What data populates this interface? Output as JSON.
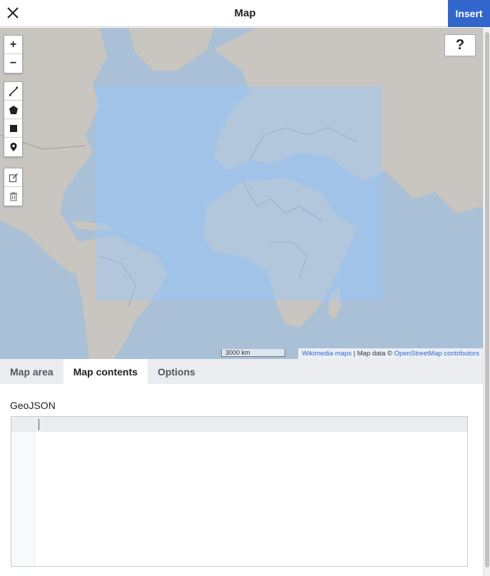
{
  "header": {
    "close_icon": "close-icon",
    "title": "Map",
    "insert_label": "Insert"
  },
  "map": {
    "help_label": "?",
    "controls": {
      "zoom_in": "+",
      "zoom_out": "−",
      "draw_line_icon": "draw-line-icon",
      "draw_polygon_icon": "draw-polygon-icon",
      "draw_rectangle_icon": "draw-rectangle-icon",
      "draw_marker_icon": "draw-marker-icon",
      "edit_layers_icon": "edit-layers-icon",
      "delete_layers_icon": "trash-icon"
    },
    "scale_label": "3000 km",
    "attribution": {
      "wikimedia_link": "Wikimedia maps",
      "separator": " | Map data © ",
      "osm_link": "OpenStreetMap contributors"
    },
    "colors": {
      "water": "#a9c0d6",
      "land": "#c9c5c0",
      "selection": "#96c8ff"
    }
  },
  "tabs": [
    {
      "label": "Map area",
      "active": false
    },
    {
      "label": "Map contents",
      "active": true
    },
    {
      "label": "Options",
      "active": false
    }
  ],
  "content": {
    "geojson_label": "GeoJSON",
    "geojson_value": ""
  }
}
